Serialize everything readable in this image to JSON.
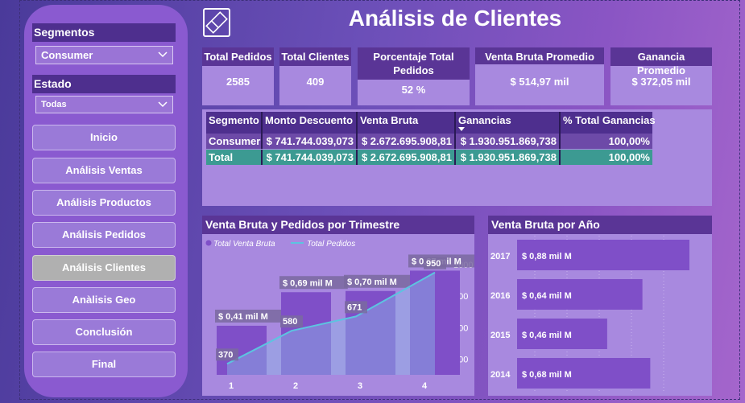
{
  "title": "Análisis de Clientes",
  "filters": {
    "segmentos": {
      "label": "Segmentos",
      "value": "Consumer"
    },
    "estado": {
      "label": "Estado",
      "value": "Todas"
    }
  },
  "nav": [
    {
      "label": "Inicio",
      "active": false
    },
    {
      "label": "Análisis Ventas",
      "active": false
    },
    {
      "label": "Análisis Productos",
      "active": false
    },
    {
      "label": "Análisis Pedidos",
      "active": false
    },
    {
      "label": "Análisis Clientes",
      "active": true
    },
    {
      "label": "Anàlisis Geo",
      "active": false
    },
    {
      "label": "Conclusión",
      "active": false
    },
    {
      "label": "Final",
      "active": false
    }
  ],
  "kpis": {
    "total_pedidos": {
      "label": "Total Pedidos",
      "value": "2585"
    },
    "total_clientes": {
      "label": "Total Clientes",
      "value": "409"
    },
    "porcentaje": {
      "label": "Porcentaje Total Pedidos",
      "value": "52 %"
    },
    "venta_bruta_prom": {
      "label": "Venta Bruta Promedio",
      "value": "$ 514,97 mil"
    },
    "ganancia_prom": {
      "label": "Ganancia Promedio",
      "value": "$ 372,05 mil"
    }
  },
  "table": {
    "headers": [
      "Segmento",
      "Monto Descuento",
      "Venta Bruta",
      "Ganancias",
      "% Total Ganancias"
    ],
    "rows": [
      [
        "Consumer",
        "$ 741.744.039,073",
        "$ 2.672.695.908,81",
        "$ 1.930.951.869,738",
        "100,00%"
      ]
    ],
    "total": [
      "Total",
      "$ 741.744.039,073",
      "$ 2.672.695.908,81",
      "$ 1.930.951.869,738",
      "100,00%"
    ]
  },
  "colors": {
    "accent": "#5a3596",
    "bar": "#7f4fc8",
    "line": "#5cc4e0",
    "total_row": "#3c9a92"
  },
  "chart_data": [
    {
      "type": "bar",
      "title": "Venta Bruta y Pedidos por Trimestre",
      "categories": [
        "1",
        "2",
        "3",
        "4"
      ],
      "series": [
        {
          "name": "Total Venta Bruta",
          "values": [
            0.41,
            0.69,
            0.7,
            0.87
          ],
          "labels": [
            "$ 0,41 mil M",
            "$ 0,69 mil M",
            "$ 0,70 mil M",
            "$ 0,87 mil M"
          ]
        },
        {
          "name": "Total Pedidos",
          "type": "line",
          "values": [
            370,
            580,
            671,
            950
          ]
        }
      ],
      "y2_ticks": [
        "1000",
        "800",
        "600",
        "400"
      ],
      "y2lim": [
        300,
        1000
      ],
      "legend": "top-left"
    },
    {
      "type": "bar",
      "orientation": "horizontal",
      "title": "Venta Bruta por Año",
      "categories": [
        "2017",
        "2016",
        "2015",
        "2014"
      ],
      "values": [
        0.88,
        0.64,
        0.46,
        0.68
      ],
      "labels": [
        "$ 0,88 mil M",
        "$ 0,64 mil M",
        "$ 0,46 mil M",
        "$ 0,68 mil M"
      ]
    }
  ]
}
